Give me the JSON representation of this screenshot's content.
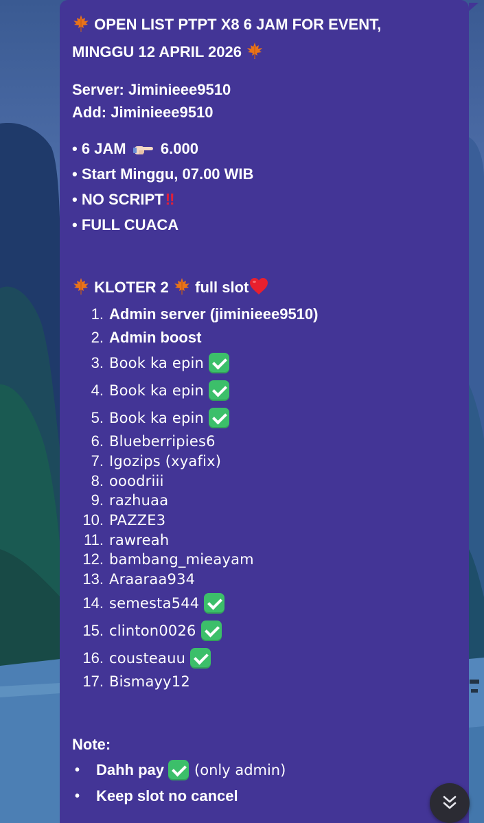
{
  "message": {
    "title_line1": "OPEN LIST PTPT X8 6 JAM FOR EVENT,",
    "title_line2": "MINGGU 12 APRIL 2026",
    "server_label": "Server:",
    "server_value": "Jiminieee9510",
    "add_label": "Add:",
    "add_value": "Jiminieee9510",
    "details": [
      {
        "bullet": "•",
        "text": "6 JAM",
        "price": "6.000"
      },
      {
        "bullet": "•",
        "text": "Start Minggu, 07.00 WIB"
      },
      {
        "bullet": "•",
        "text": "NO SCRIPT",
        "mark": "‼"
      },
      {
        "bullet": "•",
        "text": "FULL CUACA"
      }
    ],
    "kloter": {
      "label": "KLOTER 2",
      "status": "full slot"
    },
    "slots": [
      {
        "num": "1.",
        "name": "Admin server (jiminieee9510)"
      },
      {
        "num": "2.",
        "name": "Admin boost"
      },
      {
        "num": "3.",
        "name": "Book ka epin"
      },
      {
        "num": "4.",
        "name": "Book ka epin"
      },
      {
        "num": "5.",
        "name": "Book ka epin"
      },
      {
        "num": "6.",
        "name": "Blueberripies6"
      },
      {
        "num": "7.",
        "name": "Igozips (xyafix)"
      },
      {
        "num": "8.",
        "name": "ooodriii"
      },
      {
        "num": "9.",
        "name": "razhuaa"
      },
      {
        "num": "10.",
        "name": "PAZZE3"
      },
      {
        "num": "11.",
        "name": "rawreah"
      },
      {
        "num": "12.",
        "name": "bambang_mieayam"
      },
      {
        "num": "13.",
        "name": "Araaraa934"
      },
      {
        "num": "14.",
        "name": "semesta544"
      },
      {
        "num": "15.",
        "name": "clinton0026"
      },
      {
        "num": "16.",
        "name": "cousteauu"
      },
      {
        "num": "17.",
        "name": "Bismayy12"
      }
    ],
    "note_label": "Note:",
    "notes": [
      {
        "bullet": "•",
        "text": "Dahh pay",
        "extra": "(only admin)"
      },
      {
        "bullet": "•",
        "text": "Keep slot no cancel"
      }
    ]
  },
  "icons": {
    "leaf": "maple-leaf-icon",
    "point": "backhand-index-pointing-right-icon",
    "check": "white-check-mark-icon",
    "heart": "red-heart-icon",
    "scroll": "double-chevron-down-icon"
  },
  "colors": {
    "bubble": "#433596",
    "check": "#3cbf6a",
    "heart": "#e8202e",
    "leaf": "#e8731a",
    "scroll_button": "#2b2b33"
  }
}
